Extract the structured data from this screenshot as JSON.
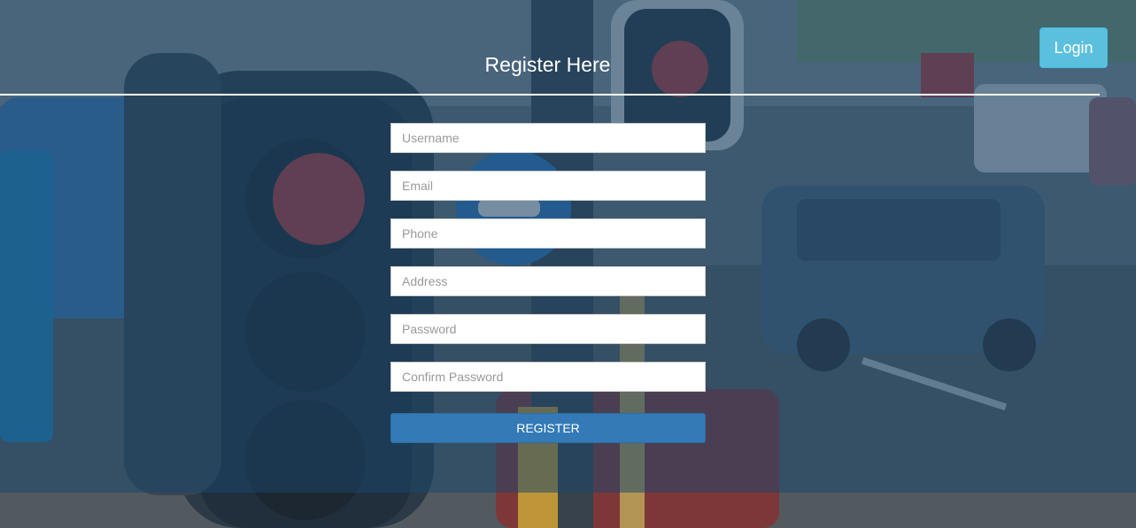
{
  "header": {
    "title": "Register Here",
    "login_label": "Login"
  },
  "form": {
    "fields": [
      {
        "name": "username",
        "placeholder": "Username",
        "value": ""
      },
      {
        "name": "email",
        "placeholder": "Email",
        "value": ""
      },
      {
        "name": "phone",
        "placeholder": "Phone",
        "value": ""
      },
      {
        "name": "address",
        "placeholder": "Address",
        "value": ""
      },
      {
        "name": "password",
        "placeholder": "Password",
        "value": ""
      },
      {
        "name": "confirm_password",
        "placeholder": "Confirm Password",
        "value": ""
      }
    ],
    "submit_label": "REGISTER"
  },
  "colors": {
    "overlay": "#1c4263",
    "login_button": "#5bc0de",
    "register_button": "#337ab7",
    "text": "#ffffff"
  },
  "background": {
    "subject": "traffic-light-street-photo"
  }
}
